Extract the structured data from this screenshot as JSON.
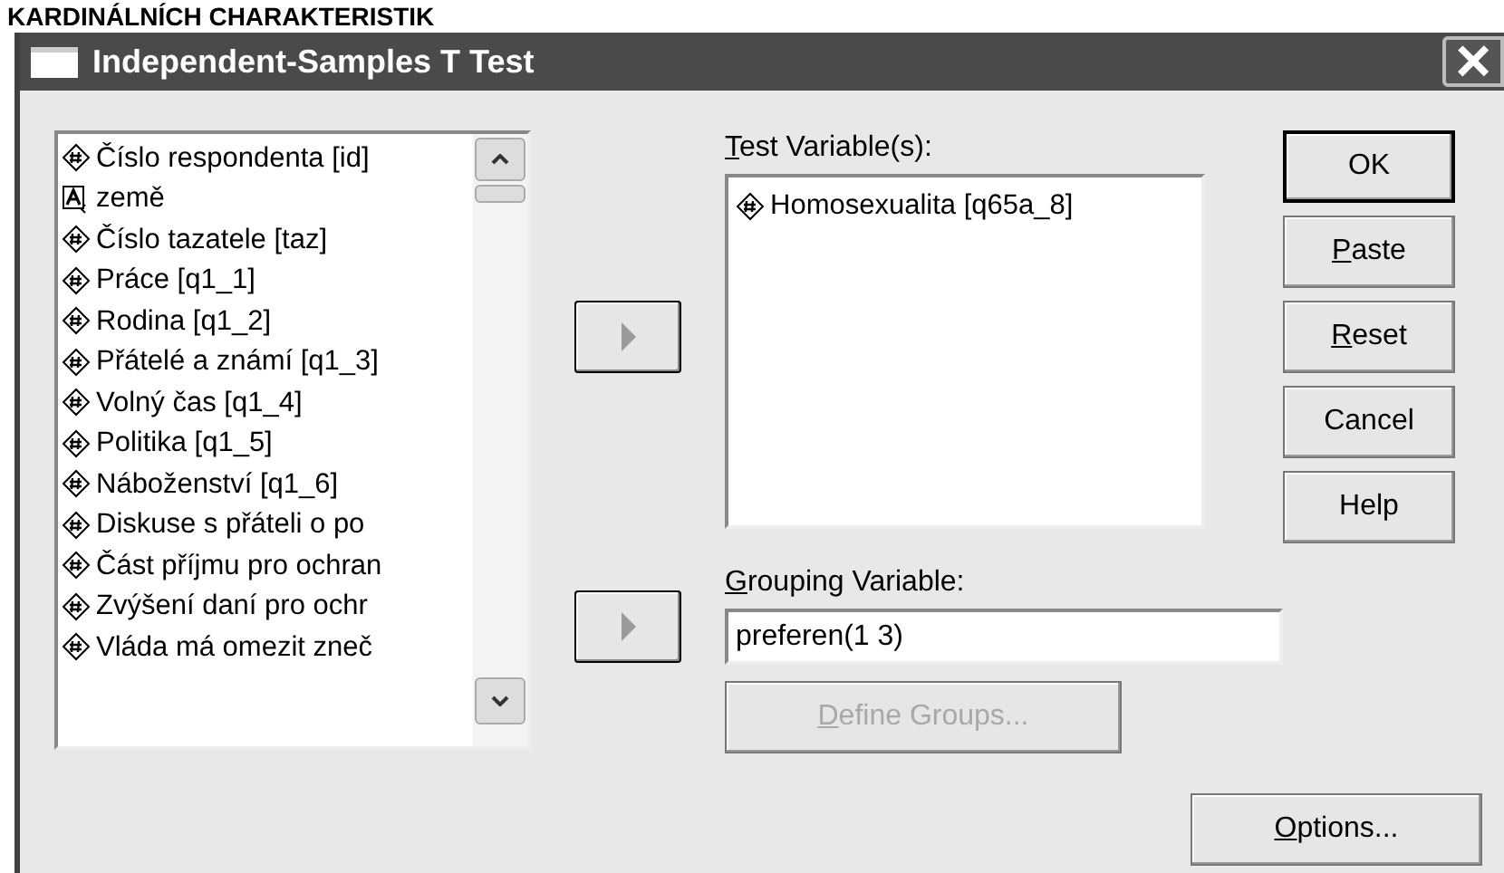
{
  "heading": "KARDINÁLNÍCH CHARAKTERISTIK",
  "window": {
    "title": "Independent-Samples T Test",
    "close": "×"
  },
  "variables": [
    {
      "kind": "numeric",
      "label": "Číslo respondenta [id]"
    },
    {
      "kind": "string",
      "label": "země"
    },
    {
      "kind": "numeric",
      "label": "Číslo tazatele [taz]"
    },
    {
      "kind": "numeric",
      "label": "Práce [q1_1]"
    },
    {
      "kind": "numeric",
      "label": "Rodina [q1_2]"
    },
    {
      "kind": "numeric",
      "label": "Přátelé a známí [q1_3]"
    },
    {
      "kind": "numeric",
      "label": "Volný čas [q1_4]"
    },
    {
      "kind": "numeric",
      "label": "Politika [q1_5]"
    },
    {
      "kind": "numeric",
      "label": "Náboženství [q1_6]"
    },
    {
      "kind": "numeric",
      "label": "Diskuse s přáteli o po"
    },
    {
      "kind": "numeric",
      "label": "Část příjmu pro ochran"
    },
    {
      "kind": "numeric",
      "label": "Zvýšení daní pro ochr"
    },
    {
      "kind": "numeric",
      "label": "Vláda má omezit zneč"
    }
  ],
  "test_variables": {
    "label": "Test Variable(s):",
    "access_key": true,
    "items": [
      {
        "kind": "numeric",
        "label": "Homosexualita [q65a_8]"
      }
    ]
  },
  "grouping_variable": {
    "label": "Grouping Variable:",
    "access_key": true,
    "value": "preferen(1 3)"
  },
  "define_groups": {
    "label": "Define Groups...",
    "access_key": true,
    "disabled": true
  },
  "buttons": [
    {
      "label": "OK",
      "access_key": false,
      "default": true
    },
    {
      "label": "Paste",
      "access_key": true,
      "default": false
    },
    {
      "label": "Reset",
      "access_key": true,
      "default": false
    },
    {
      "label": "Cancel",
      "access_key": false,
      "default": false
    },
    {
      "label": "Help",
      "access_key": false,
      "default": false
    }
  ],
  "options": {
    "label": "Options...",
    "access_key": true
  }
}
